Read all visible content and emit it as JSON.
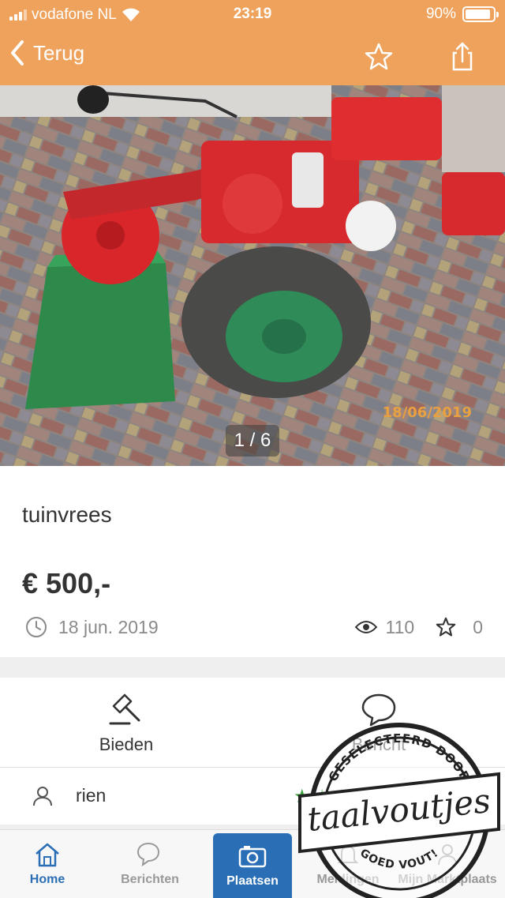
{
  "status": {
    "carrier": "vodafone NL",
    "time": "23:19",
    "battery": "90%",
    "battery_level": 0.9
  },
  "nav": {
    "back_label": "Terug"
  },
  "photo": {
    "counter": "1 / 6",
    "date_stamp": "18/06/2019"
  },
  "listing": {
    "title": "tuinvrees",
    "price": "€ 500,-",
    "date": "18 jun. 2019",
    "views": "110",
    "favorites": "0"
  },
  "actions": {
    "bid_label": "Bieden",
    "message_label": "Bericht"
  },
  "seller": {
    "name": "rien",
    "rating_stars": 5
  },
  "tabs": {
    "home": "Home",
    "messages": "Berichten",
    "place": "Plaatsen",
    "notifications": "Meldingen",
    "my": "Mijn Marktplaats"
  },
  "stamp": {
    "brand": "taalvoutjes",
    "top_text": "GESELECTEERD DOOR",
    "bottom_text": "GOED VOUT!"
  },
  "colors": {
    "header": "#eea25c",
    "accent": "#2a6fb5",
    "rating": "#3aa53a"
  }
}
